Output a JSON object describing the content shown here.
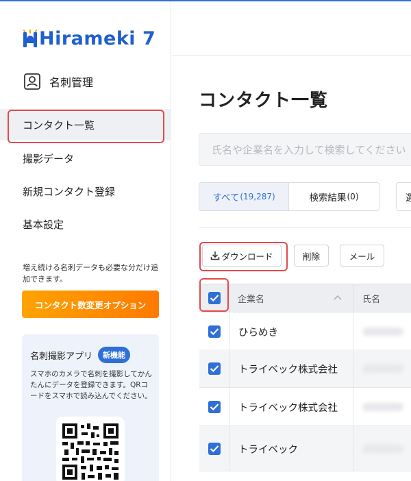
{
  "app": {
    "brand": "Hirameki 7",
    "accent_color": "#2f6fd8",
    "highlight_color": "#e24a4a",
    "option_color": "#ff8a00"
  },
  "sidebar": {
    "section": {
      "icon": "business-card-icon",
      "label": "名刺管理"
    },
    "items": [
      {
        "label": "コンタクト一覧",
        "active": true
      },
      {
        "label": "撮影データ",
        "active": false
      },
      {
        "label": "新規コンタクト登録",
        "active": false
      },
      {
        "label": "基本設定",
        "active": false
      }
    ],
    "option_note": "増え続ける名刺データも必要な分だけ追加できます。",
    "option_button": "コンタクト数変更オプション",
    "app_card": {
      "title": "名刺撮影アプリ",
      "badge": "新機能",
      "description": "スマホのカメラで名刺を撮影してかんたんにデータを登録できます。QRコードをスマホで読み込んでください。"
    }
  },
  "main": {
    "page_title": "コンタクト一覧",
    "search_placeholder": "氏名や企業名を入力して検索してください",
    "tabs": [
      {
        "label": "すべて",
        "count": "(19,287)",
        "selected": true
      },
      {
        "label": "検索結果",
        "count": "(0)",
        "selected": false
      }
    ],
    "tab3_label": "選",
    "actions": {
      "download": "ダウンロード",
      "delete": "削除",
      "mail": "メール"
    },
    "table": {
      "headers": {
        "company": "企業名",
        "name": "氏名"
      },
      "rows": [
        {
          "company": "ひらめき",
          "checked": true
        },
        {
          "company": "トライベック株式会社",
          "checked": true
        },
        {
          "company": "トライベック株式会社",
          "checked": true
        },
        {
          "company": "トライベック",
          "checked": true
        }
      ]
    }
  }
}
